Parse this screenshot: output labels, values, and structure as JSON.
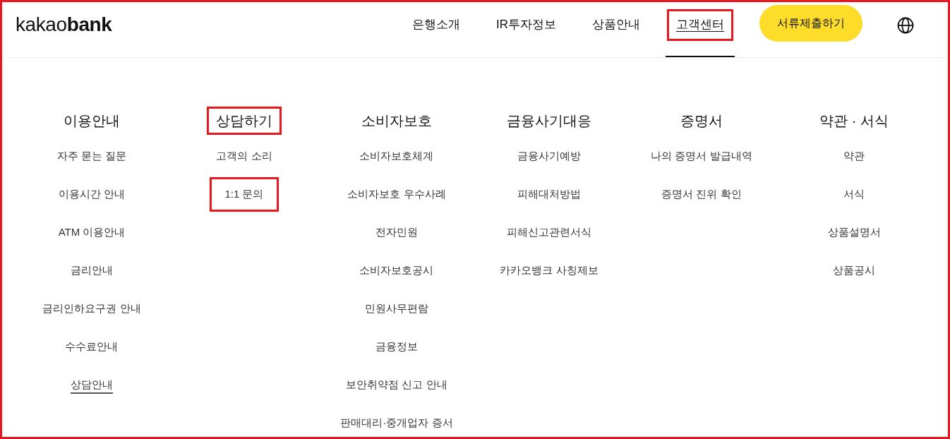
{
  "header": {
    "logo": "kakao**bank**",
    "nav": [
      {
        "label": "은행소개",
        "selected": false,
        "highlighted": false
      },
      {
        "label": "IR투자정보",
        "selected": false,
        "highlighted": false
      },
      {
        "label": "상품안내",
        "selected": false,
        "highlighted": false
      },
      {
        "label": "고객센터",
        "selected": true,
        "highlighted": true
      }
    ],
    "cta_button": {
      "label": "서류제출하기"
    }
  },
  "menu": {
    "columns": [
      {
        "heading": {
          "label": "이용안내",
          "highlighted": false
        },
        "items": [
          {
            "label": "자주 묻는 질문",
            "selected": false,
            "highlighted": false
          },
          {
            "label": "이용시간 안내",
            "selected": false,
            "highlighted": false
          },
          {
            "label": "ATM 이용안내",
            "selected": false,
            "highlighted": false
          },
          {
            "label": "금리안내",
            "selected": false,
            "highlighted": false
          },
          {
            "label": "금리인하요구권 안내",
            "selected": false,
            "highlighted": false
          },
          {
            "label": "수수료안내",
            "selected": false,
            "highlighted": false
          },
          {
            "label": "상담안내",
            "selected": true,
            "highlighted": false
          }
        ]
      },
      {
        "heading": {
          "label": "상담하기",
          "highlighted": true
        },
        "items": [
          {
            "label": "고객의 소리",
            "selected": false,
            "highlighted": false
          },
          {
            "label": "1:1 문의",
            "selected": false,
            "highlighted": true
          }
        ]
      },
      {
        "heading": {
          "label": "소비자보호",
          "highlighted": false
        },
        "items": [
          {
            "label": "소비자보호체계",
            "selected": false,
            "highlighted": false
          },
          {
            "label": "소비자보호 우수사례",
            "selected": false,
            "highlighted": false
          },
          {
            "label": "전자민원",
            "selected": false,
            "highlighted": false
          },
          {
            "label": "소비자보호공시",
            "selected": false,
            "highlighted": false
          },
          {
            "label": "민원사무편람",
            "selected": false,
            "highlighted": false
          },
          {
            "label": "금융정보",
            "selected": false,
            "highlighted": false
          },
          {
            "label": "보안취약점 신고 안내",
            "selected": false,
            "highlighted": false
          },
          {
            "label": "판매대리·중개업자 증서",
            "selected": false,
            "highlighted": false
          }
        ]
      },
      {
        "heading": {
          "label": "금융사기대응",
          "highlighted": false
        },
        "items": [
          {
            "label": "금융사기예방",
            "selected": false,
            "highlighted": false
          },
          {
            "label": "피해대처방법",
            "selected": false,
            "highlighted": false
          },
          {
            "label": "피해신고관련서식",
            "selected": false,
            "highlighted": false
          },
          {
            "label": "카카오뱅크 사칭제보",
            "selected": false,
            "highlighted": false
          }
        ]
      },
      {
        "heading": {
          "label": "증명서",
          "highlighted": false
        },
        "items": [
          {
            "label": "나의 증명서 발급내역",
            "selected": false,
            "highlighted": false
          },
          {
            "label": "증명서 진위 확인",
            "selected": false,
            "highlighted": false
          }
        ]
      },
      {
        "heading": {
          "label": "약관 · 서식",
          "highlighted": false
        },
        "items": [
          {
            "label": "약관",
            "selected": false,
            "highlighted": false
          },
          {
            "label": "서식",
            "selected": false,
            "highlighted": false
          },
          {
            "label": "상품설명서",
            "selected": false,
            "highlighted": false
          },
          {
            "label": "상품공시",
            "selected": false,
            "highlighted": false
          }
        ]
      }
    ]
  }
}
